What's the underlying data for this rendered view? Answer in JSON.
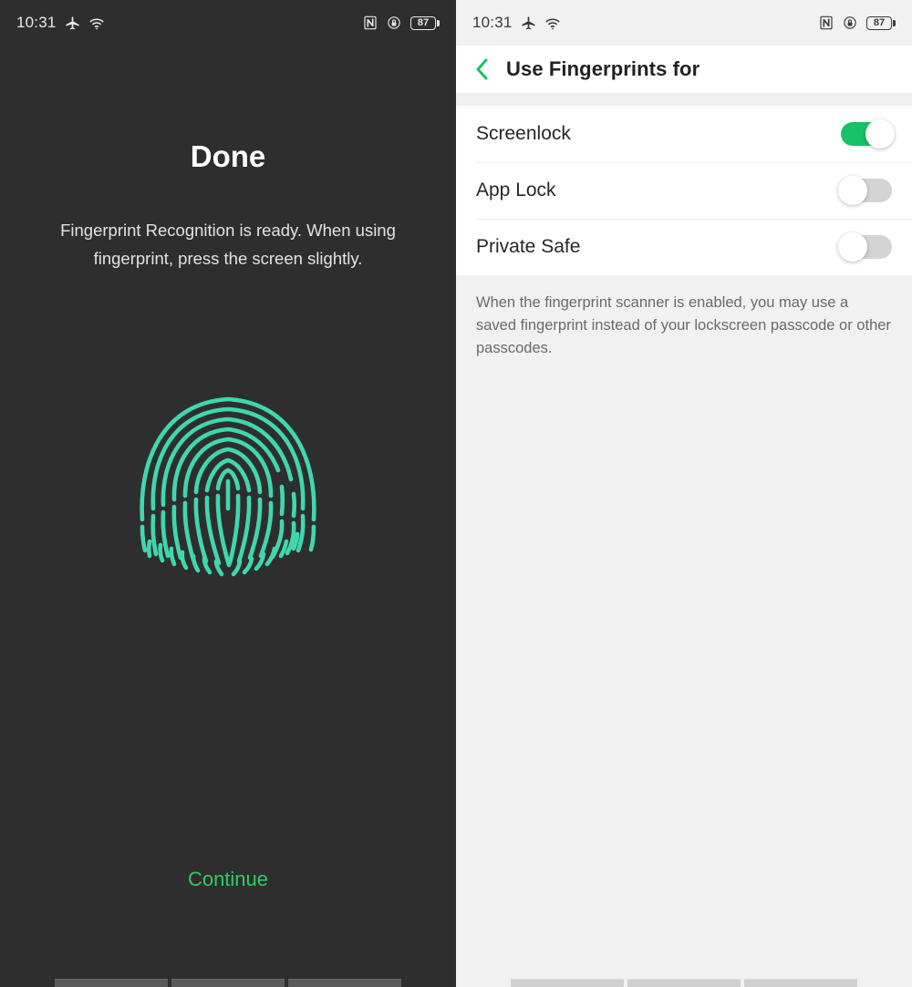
{
  "left_screen": {
    "status_bar": {
      "time": "10:31",
      "icons_left": [
        "airplane-mode-icon",
        "wifi-icon"
      ],
      "icons_right": [
        "nfc-icon",
        "lock-icon",
        "battery-icon"
      ],
      "battery_level": "87"
    },
    "title": "Done",
    "description": "Fingerprint Recognition is ready. When using fingerprint, press the screen slightly.",
    "illustration": "fingerprint-icon",
    "continue_label": "Continue",
    "colors": {
      "background": "#2e2e2e",
      "fingerprint": "#3fd7ae",
      "accent": "#2ecc63"
    }
  },
  "right_screen": {
    "status_bar": {
      "time": "10:31",
      "icons_left": [
        "airplane-mode-icon",
        "wifi-icon"
      ],
      "icons_right": [
        "nfc-icon",
        "lock-icon",
        "battery-icon"
      ],
      "battery_level": "87"
    },
    "header": {
      "back_icon": "chevron-left-icon",
      "title": "Use Fingerprints for"
    },
    "rows": [
      {
        "label": "Screenlock",
        "state": "on"
      },
      {
        "label": "App Lock",
        "state": "off"
      },
      {
        "label": "Private Safe",
        "state": "off"
      }
    ],
    "footnote": "When the fingerprint scanner is enabled, you may use a saved fingerprint instead of your lockscreen passcode or other passcodes.",
    "colors": {
      "background": "#f1f1f1",
      "card": "#ffffff",
      "accent": "#18c266"
    }
  }
}
